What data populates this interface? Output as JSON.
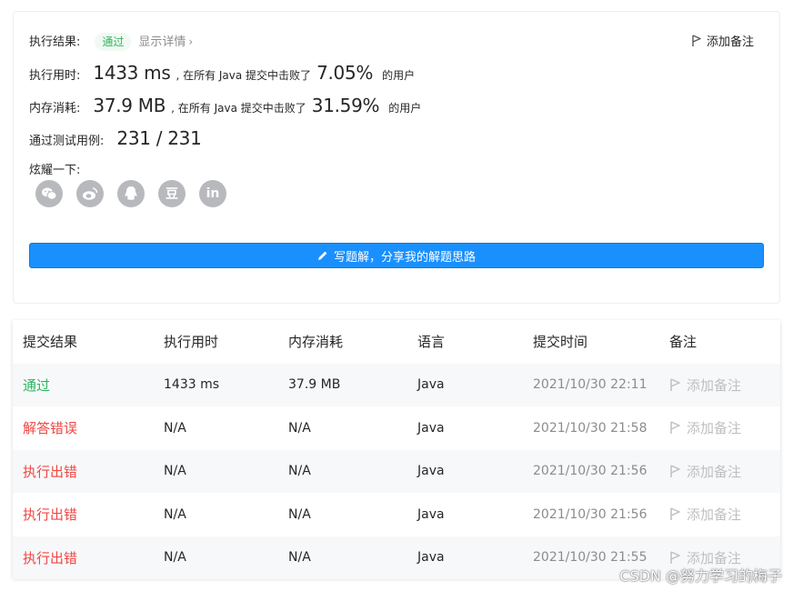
{
  "result": {
    "status_label": "执行结果:",
    "status_badge": "通过",
    "detail_link": "显示详情",
    "add_note": "添加备注",
    "runtime_label": "执行用时:",
    "runtime_value": "1433 ms",
    "runtime_mid": ", 在所有 Java 提交中击败了",
    "runtime_pct": "7.05%",
    "runtime_tail": "的用户",
    "memory_label": "内存消耗:",
    "memory_value": "37.9 MB",
    "memory_mid": ", 在所有 Java 提交中击败了",
    "memory_pct": "31.59%",
    "memory_tail": "的用户",
    "tests_label": "通过测试用例:",
    "tests_value": "231 / 231",
    "share_label": "炫耀一下:",
    "share_icons": [
      "wechat-icon",
      "weibo-icon",
      "qq-icon",
      "douban-icon",
      "linkedin-icon"
    ],
    "douban_glyph": "豆",
    "linkedin_glyph": "in",
    "write_button": "写题解，分享我的解题思路"
  },
  "table": {
    "headers": [
      "提交结果",
      "执行用时",
      "内存消耗",
      "语言",
      "提交时间",
      "备注"
    ],
    "rows": [
      {
        "status": "通过",
        "status_type": "pass",
        "runtime": "1433 ms",
        "memory": "37.9 MB",
        "language": "Java",
        "time": "2021/10/30 22:11",
        "note": "添加备注"
      },
      {
        "status": "解答错误",
        "status_type": "fail",
        "runtime": "N/A",
        "memory": "N/A",
        "language": "Java",
        "time": "2021/10/30 21:58",
        "note": "添加备注"
      },
      {
        "status": "执行出错",
        "status_type": "fail",
        "runtime": "N/A",
        "memory": "N/A",
        "language": "Java",
        "time": "2021/10/30 21:56",
        "note": "添加备注"
      },
      {
        "status": "执行出错",
        "status_type": "fail",
        "runtime": "N/A",
        "memory": "N/A",
        "language": "Java",
        "time": "2021/10/30 21:56",
        "note": "添加备注"
      },
      {
        "status": "执行出错",
        "status_type": "fail",
        "runtime": "N/A",
        "memory": "N/A",
        "language": "Java",
        "time": "2021/10/30 21:55",
        "note": "添加备注"
      }
    ]
  },
  "watermark": "CSDN @努力学习的梅子",
  "colors": {
    "pass": "#2db55d",
    "fail": "#ef4743",
    "primary": "#1a90ff"
  }
}
